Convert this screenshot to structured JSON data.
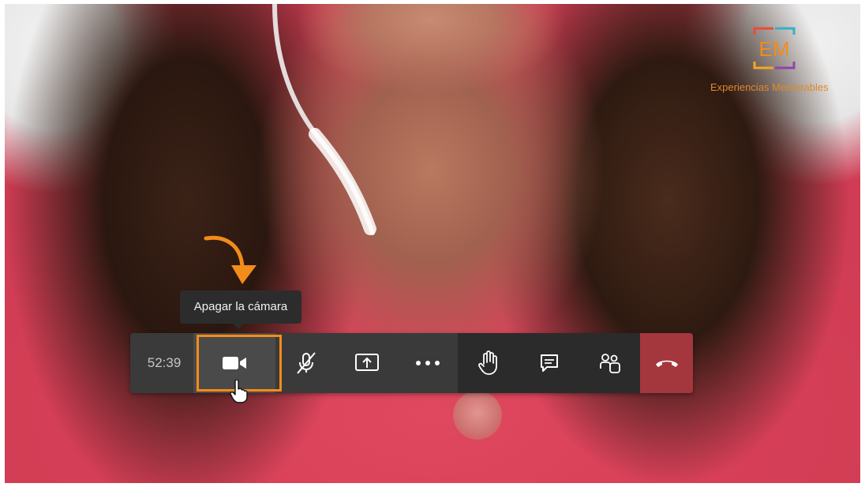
{
  "brand": {
    "logo_initials": "EM",
    "name": "Experiencias Memorables",
    "accent_color": "#f28c1a"
  },
  "tooltip": {
    "text": "Apagar la cámara"
  },
  "toolbar": {
    "timer": "52:39",
    "buttons": [
      {
        "id": "camera",
        "icon": "video-camera-icon",
        "state": "on"
      },
      {
        "id": "microphone",
        "icon": "microphone-muted-icon",
        "state": "muted"
      },
      {
        "id": "share",
        "icon": "share-screen-icon"
      },
      {
        "id": "more",
        "icon": "more-options-icon"
      },
      {
        "id": "raise-hand",
        "icon": "raise-hand-icon"
      },
      {
        "id": "chat",
        "icon": "chat-icon"
      },
      {
        "id": "participants",
        "icon": "participants-icon"
      },
      {
        "id": "hang-up",
        "icon": "hang-up-icon",
        "color": "#a4373e"
      }
    ]
  },
  "annotations": {
    "highlight_color": "#f28c1a",
    "arrow_color": "#f28c1a"
  }
}
